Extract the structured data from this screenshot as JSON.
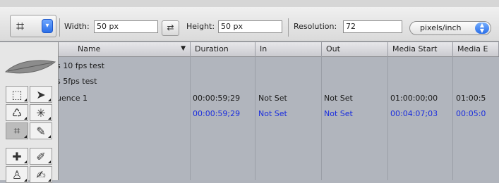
{
  "toolbar": {
    "width_label": "Width:",
    "width_value": "50 px",
    "height_label": "Height:",
    "height_value": "50 px",
    "resolution_label": "Resolution:",
    "resolution_value": "72",
    "units_value": "pixels/inch"
  },
  "table": {
    "headers": [
      "Name",
      "Duration",
      "In",
      "Out",
      "Media Start",
      "Media E"
    ],
    "rows": [
      {
        "name": "s 10 fps test",
        "duration": "",
        "in": "",
        "out": "",
        "media_start": "",
        "media_end": ""
      },
      {
        "name": "s 5fps test",
        "duration": "",
        "in": "",
        "out": "",
        "media_start": "",
        "media_end": ""
      },
      {
        "name": "uence 1",
        "duration": "00:00:59;29",
        "in": "Not Set",
        "out": "Not Set",
        "media_start": "01:00:00;00",
        "media_end": "01:00:5"
      },
      {
        "name": "",
        "duration": "00:00:59;29",
        "in": "Not Set",
        "out": "Not Set",
        "media_start": "00:04:07;03",
        "media_end": "00:05:0"
      }
    ]
  },
  "palette": {
    "tools": [
      "marquee-tool",
      "move-tool",
      "lasso-tool",
      "magic-wand-tool",
      "crop-tool",
      "slice-tool",
      "healing-brush-tool",
      "brush-tool",
      "clone-stamp-tool",
      "history-brush-tool"
    ]
  },
  "colors": {
    "accent_blue": "#2b6fe9",
    "selected_text": "#1a2dde",
    "table_background": "#b1b5bd"
  }
}
